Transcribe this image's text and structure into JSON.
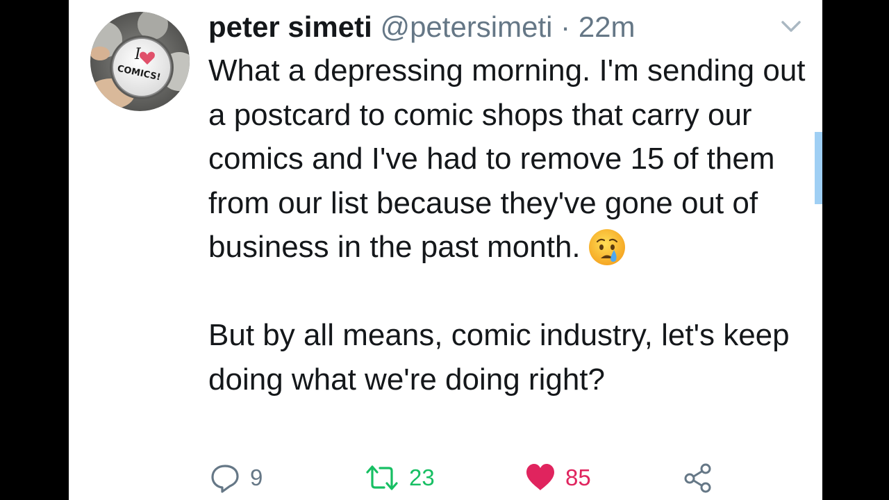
{
  "tweet": {
    "author_name": "peter simeti",
    "handle": "@petersimeti",
    "separator": "·",
    "time": "22m",
    "paragraphs": [
      "What a depressing morning. I'm sending out a postcard to comic shops that carry our comics and I've had to remove 15 of them from our list because they've gone out of business in the past month.",
      "But by all means, comic industry, let's keep doing what we're doing right?"
    ],
    "emoji": "crying-face-emoji",
    "avatar_text": {
      "line1": "I",
      "line2": "COMICS!"
    }
  },
  "actions": {
    "reply_count": "9",
    "retweet_count": "23",
    "like_count": "85"
  },
  "icons": {
    "reply": "reply-icon",
    "retweet": "retweet-icon",
    "like": "heart-icon",
    "share": "share-icon",
    "menu": "chevron-down-icon"
  },
  "colors": {
    "text_primary": "#14171a",
    "text_secondary": "#657786",
    "retweet_green": "#17bf63",
    "like_red": "#e0245e",
    "scrollbar_blue": "#9fcff4",
    "background_outer": "#000000",
    "background_card": "#ffffff"
  }
}
